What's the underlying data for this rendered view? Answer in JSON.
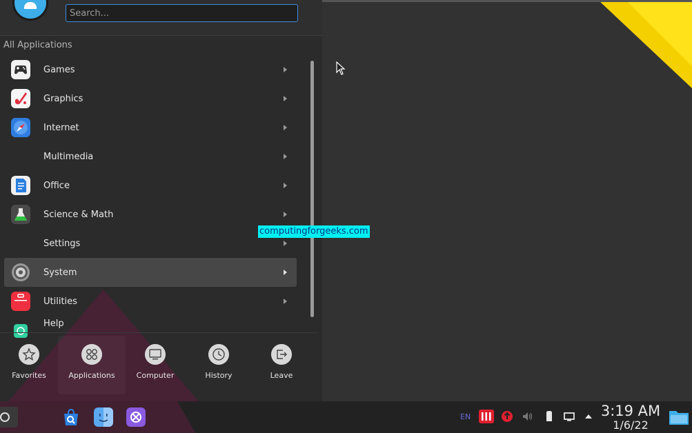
{
  "menu": {
    "search_placeholder": "Search...",
    "section_label": "All Applications",
    "categories": [
      {
        "label": "Games",
        "icon": "gamepad-icon"
      },
      {
        "label": "Graphics",
        "icon": "graphics-icon"
      },
      {
        "label": "Internet",
        "icon": "compass-icon"
      },
      {
        "label": "Multimedia",
        "icon": "multimedia-icon"
      },
      {
        "label": "Office",
        "icon": "document-icon"
      },
      {
        "label": "Science & Math",
        "icon": "flask-icon"
      },
      {
        "label": "Settings",
        "icon": "settings-icon"
      },
      {
        "label": "System",
        "icon": "gear-icon"
      },
      {
        "label": "Utilities",
        "icon": "toolbox-icon"
      },
      {
        "label": "Help",
        "icon": "help-icon"
      }
    ],
    "active_category": "System",
    "tabs": [
      {
        "label": "Favorites",
        "icon": "star-icon"
      },
      {
        "label": "Applications",
        "icon": "grid-icon"
      },
      {
        "label": "Computer",
        "icon": "monitor-icon"
      },
      {
        "label": "History",
        "icon": "clock-icon"
      },
      {
        "label": "Leave",
        "icon": "logout-icon"
      }
    ],
    "active_tab": "Applications"
  },
  "watermark": "computingforgeeks.com",
  "taskbar": {
    "keyboard_layout": "EN",
    "clock_time": "3:19 AM",
    "clock_date": "1/6/22"
  },
  "colors": {
    "accent": "#3d8ee0",
    "wallpaper_yellow": "#f5d000",
    "wallpaper_magenta": "#4a2035",
    "watermark_bg": "#00f0f0"
  }
}
